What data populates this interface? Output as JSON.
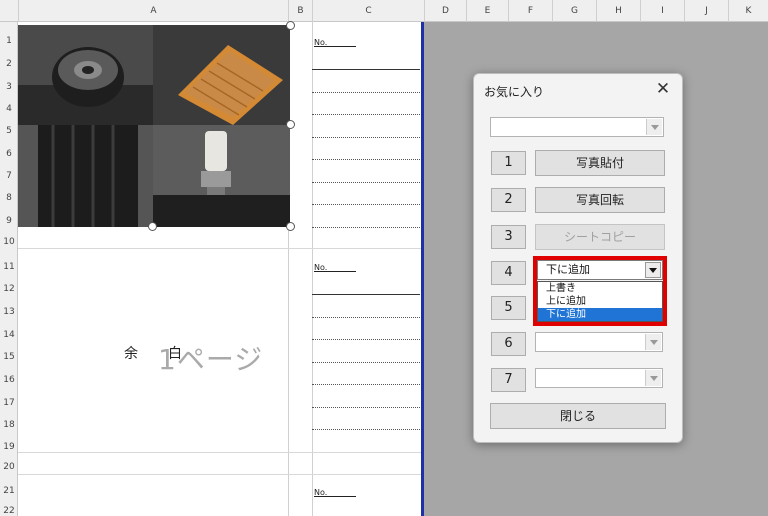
{
  "columns": [
    "A",
    "B",
    "C",
    "D",
    "E",
    "F",
    "G",
    "H",
    "I",
    "J",
    "K"
  ],
  "rows": [
    "1",
    "2",
    "3",
    "4",
    "5",
    "6",
    "7",
    "8",
    "9",
    "10",
    "11",
    "12",
    "13",
    "14",
    "15",
    "16",
    "17",
    "18",
    "19",
    "20",
    "21",
    "22"
  ],
  "sheet": {
    "no_label": "No.",
    "yohaku_left": "余",
    "yohaku_right": "白",
    "page_label": "1ページ"
  },
  "dialog": {
    "title": "お気に入り",
    "close_glyph": "✕",
    "top_combo_value": "",
    "number_buttons": [
      "1",
      "2",
      "3",
      "4",
      "5",
      "6",
      "7"
    ],
    "photo_paste_label": "写真貼付",
    "photo_rotate_label": "写真回転",
    "sheet_copy_label": "シートコピー",
    "mode_select_value": "下に追加",
    "mode_options": [
      "上書き",
      "上に追加",
      "下に追加"
    ],
    "selected_option_index": 2,
    "combo6_value": "",
    "combo7_value": "",
    "close_button_label": "閉じる"
  },
  "colors": {
    "highlight": "#e00000",
    "selection": "#1f74d6",
    "sheet_border": "#1f2fa8"
  },
  "icons": [
    "close-icon",
    "chevron-down-icon"
  ]
}
